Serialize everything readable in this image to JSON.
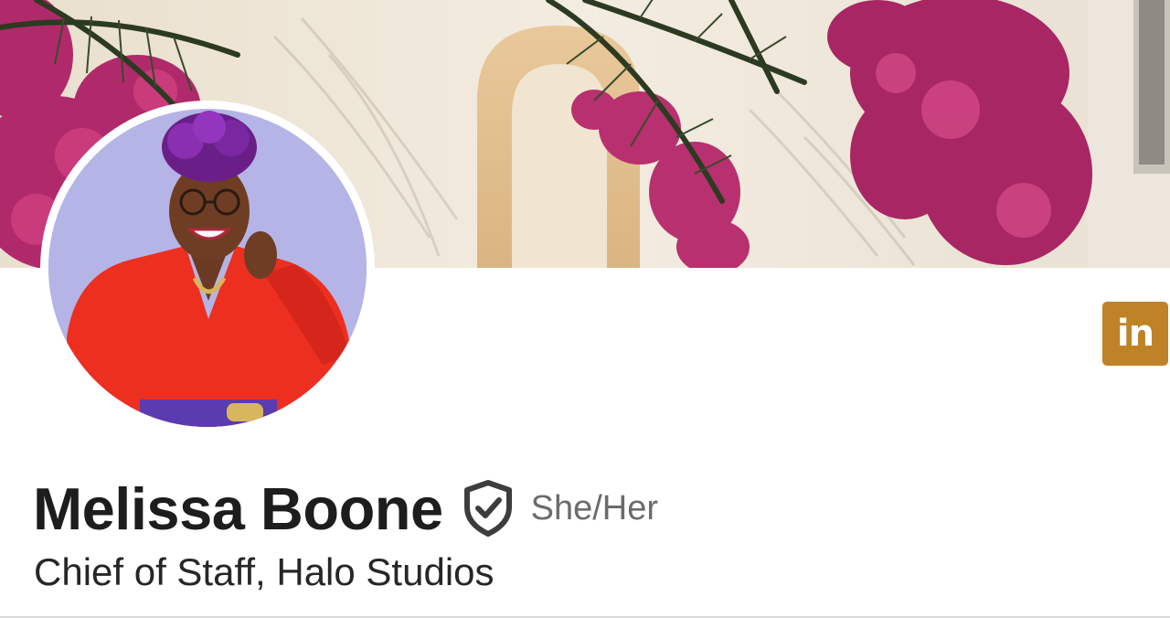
{
  "profile": {
    "name": "Melissa Boone",
    "pronouns": "She/Her",
    "headline": "Chief of Staff, Halo Studios",
    "verified_icon": "shield-check-icon"
  },
  "brand": {
    "logo_text": "in",
    "logo_icon": "linkedin-logo-icon"
  },
  "banner": {
    "description_icon": "banner-image"
  },
  "colors": {
    "brand_accent": "#c08226",
    "name_text": "#1d1d1d",
    "pronouns_text": "#6b6b6b",
    "headline_text": "#262626",
    "avatar_background": "#b5b4e6"
  }
}
